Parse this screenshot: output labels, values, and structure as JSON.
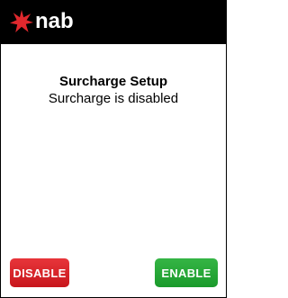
{
  "header": {
    "brand": "nab",
    "logo_icon": "nab-star-logo-icon",
    "logo_color": "#e0282d"
  },
  "content": {
    "title": "Surcharge Setup",
    "status": "Surcharge is disabled"
  },
  "actions": {
    "disable_label": "DISABLE",
    "enable_label": "ENABLE",
    "disable_color": "#d31f25",
    "enable_color": "#22a535"
  }
}
